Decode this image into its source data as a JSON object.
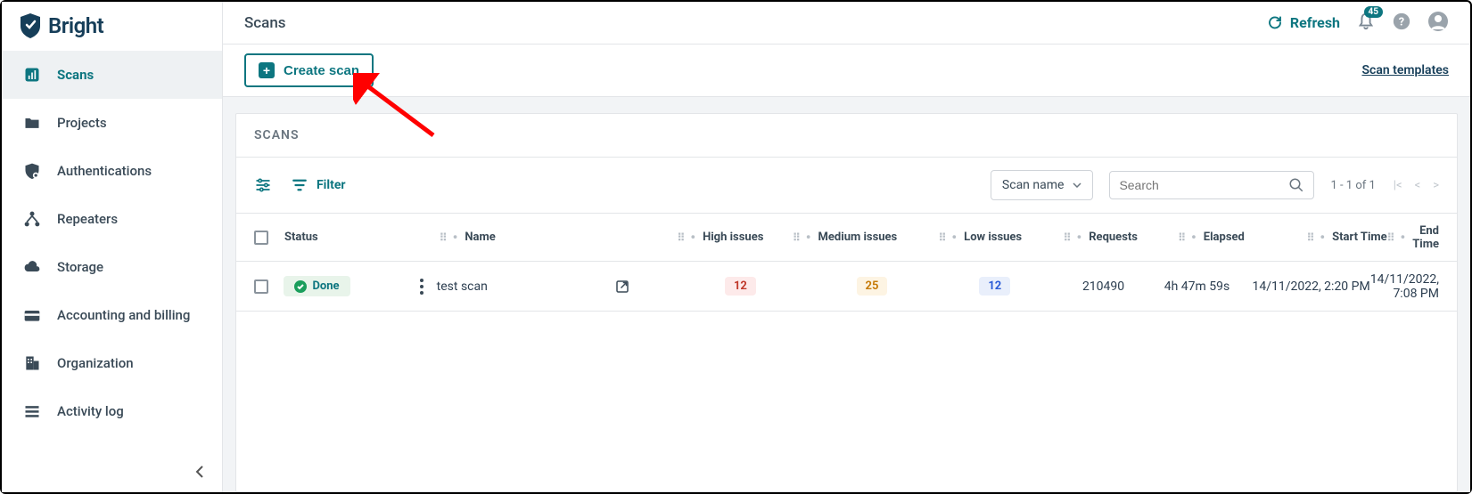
{
  "brand": {
    "name": "Bright"
  },
  "header": {
    "title": "Scans",
    "refresh": "Refresh",
    "notification_count": "45"
  },
  "sidebar": {
    "items": [
      {
        "label": "Scans"
      },
      {
        "label": "Projects"
      },
      {
        "label": "Authentications"
      },
      {
        "label": "Repeaters"
      },
      {
        "label": "Storage"
      },
      {
        "label": "Accounting and billing"
      },
      {
        "label": "Organization"
      },
      {
        "label": "Activity log"
      }
    ]
  },
  "actionbar": {
    "create_scan": "Create scan",
    "scan_templates": "Scan templates"
  },
  "scans_card": {
    "title": "SCANS",
    "filter_label": "Filter",
    "dropdown": "Scan name",
    "search_placeholder": "Search",
    "pager": "1 - 1 of 1",
    "columns": {
      "status": "Status",
      "name": "Name",
      "high": "High issues",
      "medium": "Medium issues",
      "low": "Low issues",
      "requests": "Requests",
      "elapsed": "Elapsed",
      "start": "Start Time",
      "end": "End Time"
    },
    "rows": [
      {
        "status": "Done",
        "name": "test scan",
        "high": "12",
        "medium": "25",
        "low": "12",
        "requests": "210490",
        "elapsed": "4h 47m 59s",
        "start": "14/11/2022, 2:20 PM",
        "end": "14/11/2022, 7:08 PM"
      }
    ]
  }
}
